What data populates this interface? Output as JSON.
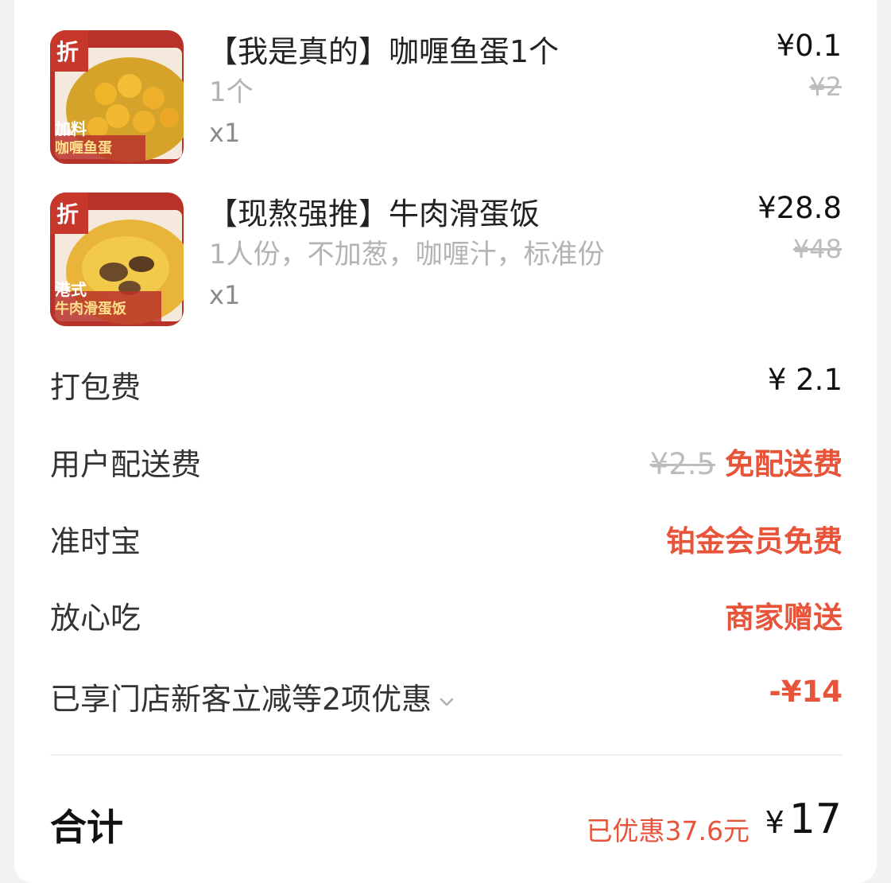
{
  "items": [
    {
      "name": "【我是真的】咖喱鱼蛋1个",
      "spec": "1个",
      "qty": "x1",
      "price": "¥0.1",
      "original_price": "¥2",
      "thumb_badge": "折",
      "thumb_caption_1": "加料",
      "thumb_caption_2": "咖喱鱼蛋"
    },
    {
      "name": "【现熬强推】牛肉滑蛋饭",
      "spec": "1人份，不加葱，咖喱汁，标准份",
      "qty": "x1",
      "price": "¥28.8",
      "original_price": "¥48",
      "thumb_badge": "折",
      "thumb_caption_1": "港式",
      "thumb_caption_2": "牛肉滑蛋饭"
    }
  ],
  "fees": {
    "packing": {
      "label": "打包费",
      "value": "¥ 2.1"
    },
    "delivery": {
      "label": "用户配送费",
      "original": "¥2.5",
      "value": "免配送费"
    },
    "ontime": {
      "label": "准时宝",
      "value": "铂金会员免费"
    },
    "assurance": {
      "label": "放心吃",
      "value": "商家赠送"
    },
    "discount": {
      "label": "已享门店新客立减等2项优惠",
      "value": "-¥14"
    }
  },
  "total": {
    "label": "合计",
    "saved": "已优惠37.6元",
    "currency": "¥",
    "amount": "17"
  },
  "colors": {
    "accent_red": "#e8543a",
    "thumb_red": "#c0392b",
    "curry_yellow": "#e8a424"
  },
  "icons": {
    "chevron": "chevron-down-icon"
  }
}
